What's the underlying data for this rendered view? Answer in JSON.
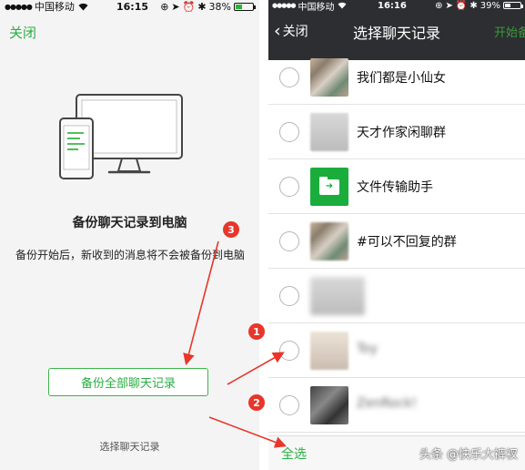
{
  "left_screen": {
    "status_bar": {
      "carrier": "中国移动",
      "time": "16:15",
      "battery": "38%"
    },
    "close_label": "关闭",
    "title": "备份聊天记录到电脑",
    "description": "备份开始后，新收到的消息将不会被备份到电脑",
    "backup_all_label": "备份全部聊天记录",
    "select_chats_label": "选择聊天记录"
  },
  "right_screen": {
    "status_bar": {
      "carrier": "中国移动",
      "time": "16:16",
      "battery": "39%"
    },
    "back_label": "关闭",
    "title": "选择聊天记录",
    "start_backup_label": "开始备份",
    "chats": [
      {
        "name": "我们都是小仙女",
        "avatar": "collage"
      },
      {
        "name": "天才作家闲聊群",
        "avatar": "collage"
      },
      {
        "name": "文件传输助手",
        "avatar": "file-transfer"
      },
      {
        "name": "#可以不回复的群",
        "avatar": "collage"
      },
      {
        "name": "",
        "avatar": "blurred"
      },
      {
        "name": "Toy",
        "avatar": "blurred"
      },
      {
        "name": "ZenRock!",
        "avatar": "dark"
      }
    ],
    "select_all_label": "全选",
    "watermark": "头条 @快乐大裤衩"
  },
  "annotations": {
    "badges": [
      "1",
      "2",
      "3"
    ],
    "color": "#e8362b"
  },
  "colors": {
    "accent": "#2aae43",
    "nav_bg": "#2d2e32"
  }
}
